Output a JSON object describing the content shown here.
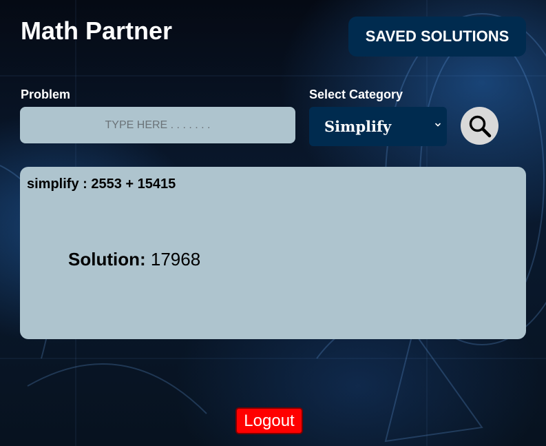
{
  "app": {
    "title": "Math Partner"
  },
  "header": {
    "saved_solutions_label": "SAVED SOLUTIONS"
  },
  "form": {
    "problem_label": "Problem",
    "problem_placeholder": "TYPE HERE . . . . . . .",
    "problem_value": "",
    "category_label": "Select Category",
    "category_selected": "Simplify",
    "search_icon": "search-icon",
    "category_chevron_icon": "chevron-down-icon"
  },
  "result": {
    "query": "simplify : 2553 + 15415",
    "solution_label": "Solution:",
    "solution_value": "17968"
  },
  "footer": {
    "logout_label": "Logout"
  },
  "colors": {
    "accent_navy": "#002b4f",
    "panel": "#aec4ce",
    "logout_red": "#ff0000",
    "text_white": "#ffffff"
  }
}
